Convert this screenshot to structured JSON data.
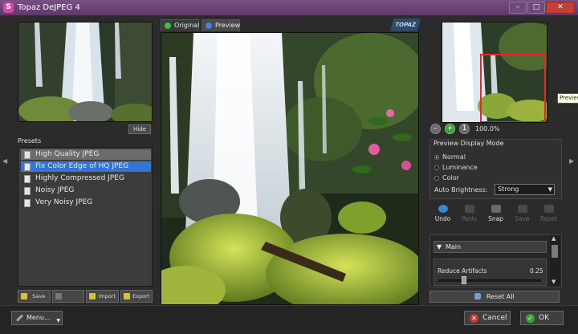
{
  "window": {
    "title": "Topaz DeJPEG 4",
    "app_icon": "S",
    "controls": {
      "minimize": "–",
      "maximize": "□",
      "close": "✕"
    }
  },
  "left_panel": {
    "hide_label": "Hide",
    "presets_label": "Presets",
    "presets": [
      {
        "label": "High Quality JPEG"
      },
      {
        "label": "Fix Color Edge of HQ JPEG"
      },
      {
        "label": "Highly Compressed JPEG"
      },
      {
        "label": "Noisy JPEG"
      },
      {
        "label": "Very Noisy JPEG"
      }
    ],
    "buttons": {
      "save": "Save",
      "delete": "",
      "import": "Import",
      "export": "Export"
    }
  },
  "tabs": {
    "original": "Original",
    "preview": "Preview"
  },
  "logo_text": "TOPAZ",
  "navigator": {
    "tooltip": "Preview",
    "zoom": {
      "minus": "–",
      "plus": "+",
      "fit": "1",
      "value": "100.0%"
    }
  },
  "preview_display_mode": {
    "title": "Preview Display Mode",
    "options": [
      {
        "label": "Normal",
        "selected": true
      },
      {
        "label": "Luminance",
        "selected": false
      },
      {
        "label": "Color",
        "selected": false
      }
    ],
    "auto_brightness_label": "Auto Brightness:",
    "auto_brightness_value": "Strong",
    "dropdown_arrow": "▼"
  },
  "tools": [
    {
      "label": "Undo",
      "enabled": true
    },
    {
      "label": "Redo",
      "enabled": false
    },
    {
      "label": "Snap",
      "enabled": true
    },
    {
      "label": "Save",
      "enabled": false
    },
    {
      "label": "Reset",
      "enabled": false
    }
  ],
  "settings": {
    "section_title": "Main",
    "section_arrow": "▼",
    "reduce_artifacts_label": "Reduce Artifacts",
    "reduce_artifacts_value": "0.25",
    "reduce_artifacts_level": 0.25,
    "scroll_up": "▲",
    "scroll_down": "▼",
    "reset_all_label": "Reset All"
  },
  "side_arrows": {
    "left": "◀",
    "right": "▶"
  },
  "bottom_bar": {
    "menu_label": "Menu...",
    "menu_arrow": "▼",
    "cancel_label": "Cancel",
    "cancel_glyph": "✕",
    "ok_label": "OK",
    "ok_glyph": "✓"
  },
  "colors": {
    "titlebar": "#6b4578",
    "selection": "#3375d6",
    "ok_green": "#3aa63a",
    "cancel_red": "#c93a2e"
  }
}
